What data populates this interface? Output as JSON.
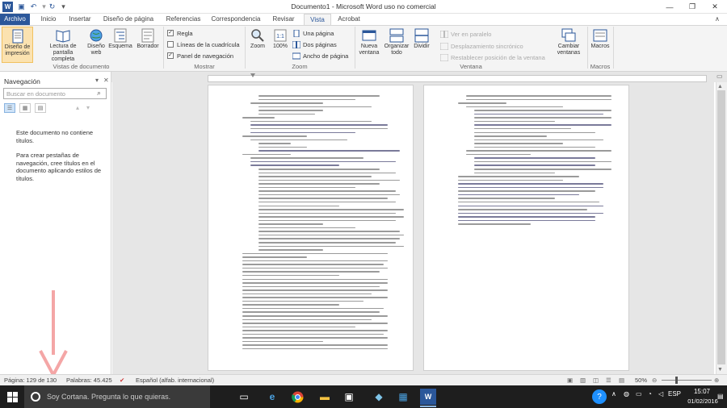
{
  "window": {
    "title": "Documento1 - Microsoft Word uso no comercial"
  },
  "tabs": [
    "Archivo",
    "Inicio",
    "Insertar",
    "Diseño de página",
    "Referencias",
    "Correspondencia",
    "Revisar",
    "Vista",
    "Acrobat"
  ],
  "ribbon": {
    "vistas": {
      "group": "Vistas de documento",
      "buttons": [
        "Diseño de impresión",
        "Lectura de pantalla completa",
        "Diseño web",
        "Esquema",
        "Borrador"
      ]
    },
    "mostrar": {
      "group": "Mostrar",
      "regla": "Regla",
      "lineas": "Líneas de la cuadrícula",
      "panel": "Panel de navegación",
      "regla_checked": true,
      "lineas_checked": false,
      "panel_checked": true
    },
    "zoom": {
      "group": "Zoom",
      "zoom": "Zoom",
      "cien": "100%",
      "una": "Una página",
      "dos": "Dos páginas",
      "ancho": "Ancho de página"
    },
    "ventana": {
      "group": "Ventana",
      "nueva": "Nueva ventana",
      "organizar": "Organizar todo",
      "dividir": "Dividir",
      "paralelo": "Ver en paralelo",
      "sincronico": "Desplazamiento sincrónico",
      "restablecer": "Restablecer posición de la ventana",
      "cambiar": "Cambiar ventanas"
    },
    "macros": {
      "group": "Macros",
      "macros": "Macros"
    }
  },
  "nav": {
    "title": "Navegación",
    "search_placeholder": "Buscar en documento",
    "msg1": "Este documento no contiene títulos.",
    "msg2": "Para crear pestañas de navegación, cree títulos en el documento aplicando estilos de títulos."
  },
  "status": {
    "pagina": "Página: 129 de 130",
    "palabras": "Palabras: 45.425",
    "idioma": "Español (alfab. internacional)",
    "zoom": "50%"
  },
  "taskbar": {
    "cortana": "Soy Cortana. Pregunta lo que quieras.",
    "lang": "ESP",
    "time": "15:07",
    "date": "01/02/2016"
  },
  "colors": {
    "accent": "#2b579a",
    "taskbar": "#1e1e1e",
    "selected": "#fbe2b0",
    "arrow": "#f4a6a6"
  }
}
